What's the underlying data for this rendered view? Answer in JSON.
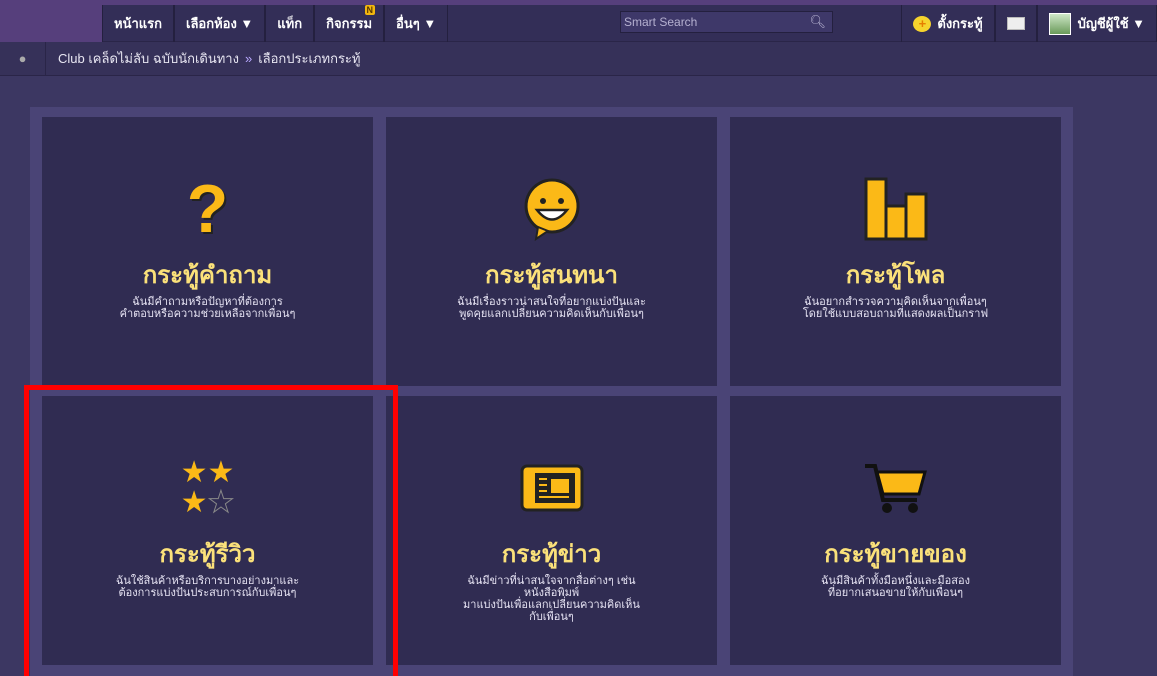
{
  "nav": {
    "items": [
      "หน้าแรก",
      "เลือกห้อง ▼",
      "แท็ก",
      "กิจกรรม",
      "อื่นๆ ▼"
    ],
    "badge": "N",
    "search_placeholder": "Smart Search",
    "new_topic": "ตั้งกระทู้",
    "account": "บัญชีผู้ใช้ ▼"
  },
  "breadcrumb": {
    "club": "Club เคล็ดไม่ลับ ฉบับนักเดินทาง",
    "sep": "»",
    "current": "เลือกประเภทกระทู้"
  },
  "cards": [
    {
      "title": "กระทู้คำถาม",
      "desc": "ฉันมีคำถามหรือปัญหาที่ต้องการ\nคำตอบหรือความช่วยเหลือจากเพื่อนๆ",
      "icon": "question-icon"
    },
    {
      "title": "กระทู้สนทนา",
      "desc": "ฉันมีเรื่องราวน่าสนใจที่อยากแบ่งปันและ\nพูดคุยแลกเปลี่ยนความคิดเห็นกับเพื่อนๆ",
      "icon": "smiley-icon"
    },
    {
      "title": "กระทู้โพล",
      "desc": "ฉันอยากสำรวจความคิดเห็นจากเพื่อนๆ\nโดยใช้แบบสอบถามที่แสดงผลเป็นกราฟ",
      "icon": "bar-chart-icon"
    },
    {
      "title": "กระทู้รีวิว",
      "desc": "ฉันใช้สินค้าหรือบริการบางอย่างมาและ\nต้องการแบ่งปันประสบการณ์กับเพื่อนๆ",
      "icon": "stars-icon"
    },
    {
      "title": "กระทู้ข่าว",
      "desc": "ฉันมีข่าวที่น่าสนใจจากสื่อต่างๆ เช่น\nหนังสือพิมพ์\nมาแบ่งปันเพื่อแลกเปลี่ยนความคิดเห็น\nกับเพื่อนๆ",
      "icon": "newspaper-icon"
    },
    {
      "title": "กระทู้ขายของ",
      "desc": "ฉันมีสินค้าทั้งมือหนึ่งและมือสอง\nที่อยากเสนอขายให้กับเพื่อนๆ",
      "icon": "cart-icon"
    }
  ],
  "colors": {
    "accent": "#fbe17a",
    "highlight": "#ff0000"
  }
}
